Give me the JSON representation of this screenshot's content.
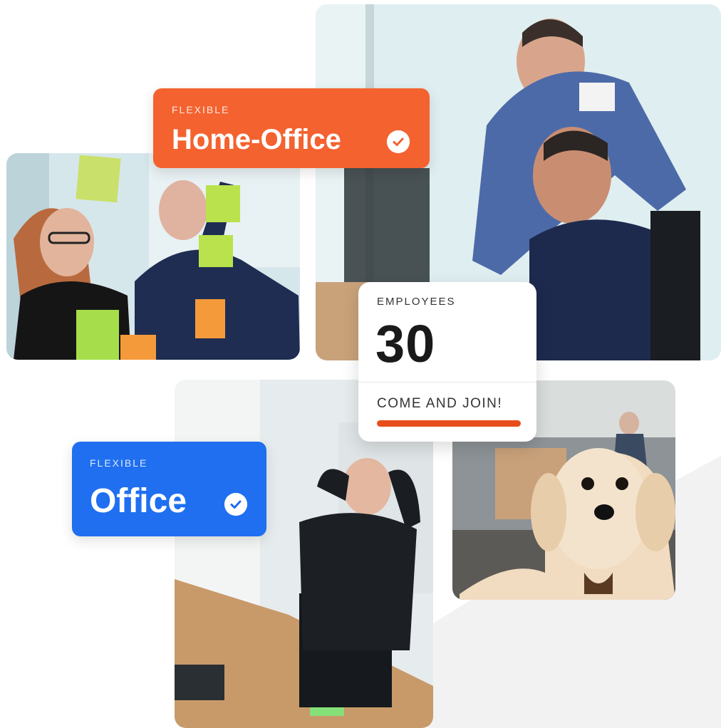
{
  "home_office_badge": {
    "kicker": "FLEXIBLE",
    "title": "Home-Office",
    "icon": "check-circle-icon",
    "color": "#f4622f"
  },
  "office_badge": {
    "kicker": "FLEXIBLE",
    "title": "Office",
    "icon": "check-circle-icon",
    "color": "#1f6ff0"
  },
  "employees_card": {
    "label": "EMPLOYEES",
    "count": "30",
    "cta": "COME AND JOIN!",
    "accent": "#e84d1c"
  }
}
